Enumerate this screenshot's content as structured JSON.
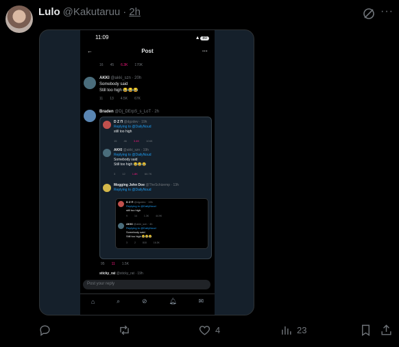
{
  "tweet": {
    "name": "Lulo",
    "handle": "@Kakutaruu",
    "dot": "·",
    "time": "2h"
  },
  "phone": {
    "clock": "11:09",
    "battery": "80",
    "title": "Post",
    "top_stats": [
      "16",
      "45",
      "6.3K",
      "170K"
    ],
    "akki1": {
      "name": "AKKI",
      "meta": "@akki_szn · 20h",
      "line1": "Somebody said",
      "line2": "Still too high 😂😂😂",
      "stats": [
        "11",
        "13",
        "4.5K",
        "67K"
      ]
    },
    "braden": {
      "name": "Braden",
      "meta": "@Dj_DErpS_s_LoT · 2h"
    },
    "q1": {
      "name": "D Z Π",
      "meta": "@dgzdev · 19h",
      "reply": "Replying to @DailyNoud",
      "text": "still too high",
      "stats": [
        "15",
        "46",
        "3.4K",
        "104K"
      ]
    },
    "q2": {
      "name": "AKKI",
      "meta": "@akki_szn · 19h",
      "reply": "Replying to @DailyNoud",
      "line1": "Somebody said",
      "line2": "Still too high 😂😂😂",
      "stats": [
        "3",
        "12",
        "1.8K",
        "60.7K"
      ]
    },
    "q3": {
      "name": "Mogging John Doe",
      "meta": "@TheSchizemp · 13h",
      "reply": "Replying to @DailyNoud"
    },
    "q4": {
      "name": "D Z Π",
      "meta": "@dgzdev · 19h",
      "reply": "Replying to @DailyNoud",
      "text": "still too high",
      "stats": [
        "9",
        "14",
        "1.3K",
        "44.9K"
      ]
    },
    "q5": {
      "name": "AKKI",
      "meta": "@akki_szn · 4h",
      "reply": "Replying to @DailyNoud",
      "line1": "Somebody said",
      "line2": "Still too high 😂😂😂",
      "stats": [
        "3",
        "2",
        "818",
        "16.3K"
      ]
    },
    "bottom_stats": [
      "95",
      "11",
      "1.5K"
    ],
    "next_name": "sticky_rat",
    "next_meta": "@sticky_rat · 19h",
    "reply_placeholder": "Post your reply"
  },
  "actions": {
    "likes": "4",
    "views": "23"
  }
}
